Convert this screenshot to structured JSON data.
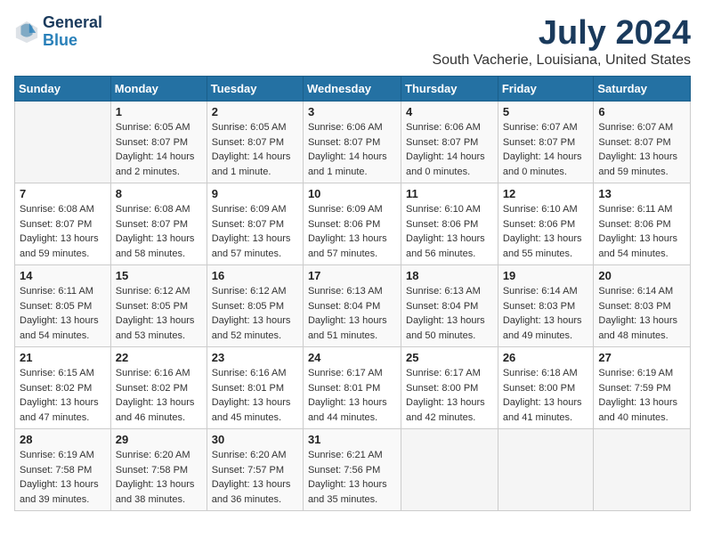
{
  "header": {
    "logo_line1": "General",
    "logo_line2": "Blue",
    "title": "July 2024",
    "location": "South Vacherie, Louisiana, United States"
  },
  "weekdays": [
    "Sunday",
    "Monday",
    "Tuesday",
    "Wednesday",
    "Thursday",
    "Friday",
    "Saturday"
  ],
  "weeks": [
    [
      {
        "day": "",
        "sunrise": "",
        "sunset": "",
        "daylight": ""
      },
      {
        "day": "1",
        "sunrise": "6:05 AM",
        "sunset": "8:07 PM",
        "daylight": "14 hours and 2 minutes."
      },
      {
        "day": "2",
        "sunrise": "6:05 AM",
        "sunset": "8:07 PM",
        "daylight": "14 hours and 1 minute."
      },
      {
        "day": "3",
        "sunrise": "6:06 AM",
        "sunset": "8:07 PM",
        "daylight": "14 hours and 1 minute."
      },
      {
        "day": "4",
        "sunrise": "6:06 AM",
        "sunset": "8:07 PM",
        "daylight": "14 hours and 0 minutes."
      },
      {
        "day": "5",
        "sunrise": "6:07 AM",
        "sunset": "8:07 PM",
        "daylight": "14 hours and 0 minutes."
      },
      {
        "day": "6",
        "sunrise": "6:07 AM",
        "sunset": "8:07 PM",
        "daylight": "13 hours and 59 minutes."
      }
    ],
    [
      {
        "day": "7",
        "sunrise": "6:08 AM",
        "sunset": "8:07 PM",
        "daylight": "13 hours and 59 minutes."
      },
      {
        "day": "8",
        "sunrise": "6:08 AM",
        "sunset": "8:07 PM",
        "daylight": "13 hours and 58 minutes."
      },
      {
        "day": "9",
        "sunrise": "6:09 AM",
        "sunset": "8:07 PM",
        "daylight": "13 hours and 57 minutes."
      },
      {
        "day": "10",
        "sunrise": "6:09 AM",
        "sunset": "8:06 PM",
        "daylight": "13 hours and 57 minutes."
      },
      {
        "day": "11",
        "sunrise": "6:10 AM",
        "sunset": "8:06 PM",
        "daylight": "13 hours and 56 minutes."
      },
      {
        "day": "12",
        "sunrise": "6:10 AM",
        "sunset": "8:06 PM",
        "daylight": "13 hours and 55 minutes."
      },
      {
        "day": "13",
        "sunrise": "6:11 AM",
        "sunset": "8:06 PM",
        "daylight": "13 hours and 54 minutes."
      }
    ],
    [
      {
        "day": "14",
        "sunrise": "6:11 AM",
        "sunset": "8:05 PM",
        "daylight": "13 hours and 54 minutes."
      },
      {
        "day": "15",
        "sunrise": "6:12 AM",
        "sunset": "8:05 PM",
        "daylight": "13 hours and 53 minutes."
      },
      {
        "day": "16",
        "sunrise": "6:12 AM",
        "sunset": "8:05 PM",
        "daylight": "13 hours and 52 minutes."
      },
      {
        "day": "17",
        "sunrise": "6:13 AM",
        "sunset": "8:04 PM",
        "daylight": "13 hours and 51 minutes."
      },
      {
        "day": "18",
        "sunrise": "6:13 AM",
        "sunset": "8:04 PM",
        "daylight": "13 hours and 50 minutes."
      },
      {
        "day": "19",
        "sunrise": "6:14 AM",
        "sunset": "8:03 PM",
        "daylight": "13 hours and 49 minutes."
      },
      {
        "day": "20",
        "sunrise": "6:14 AM",
        "sunset": "8:03 PM",
        "daylight": "13 hours and 48 minutes."
      }
    ],
    [
      {
        "day": "21",
        "sunrise": "6:15 AM",
        "sunset": "8:02 PM",
        "daylight": "13 hours and 47 minutes."
      },
      {
        "day": "22",
        "sunrise": "6:16 AM",
        "sunset": "8:02 PM",
        "daylight": "13 hours and 46 minutes."
      },
      {
        "day": "23",
        "sunrise": "6:16 AM",
        "sunset": "8:01 PM",
        "daylight": "13 hours and 45 minutes."
      },
      {
        "day": "24",
        "sunrise": "6:17 AM",
        "sunset": "8:01 PM",
        "daylight": "13 hours and 44 minutes."
      },
      {
        "day": "25",
        "sunrise": "6:17 AM",
        "sunset": "8:00 PM",
        "daylight": "13 hours and 42 minutes."
      },
      {
        "day": "26",
        "sunrise": "6:18 AM",
        "sunset": "8:00 PM",
        "daylight": "13 hours and 41 minutes."
      },
      {
        "day": "27",
        "sunrise": "6:19 AM",
        "sunset": "7:59 PM",
        "daylight": "13 hours and 40 minutes."
      }
    ],
    [
      {
        "day": "28",
        "sunrise": "6:19 AM",
        "sunset": "7:58 PM",
        "daylight": "13 hours and 39 minutes."
      },
      {
        "day": "29",
        "sunrise": "6:20 AM",
        "sunset": "7:58 PM",
        "daylight": "13 hours and 38 minutes."
      },
      {
        "day": "30",
        "sunrise": "6:20 AM",
        "sunset": "7:57 PM",
        "daylight": "13 hours and 36 minutes."
      },
      {
        "day": "31",
        "sunrise": "6:21 AM",
        "sunset": "7:56 PM",
        "daylight": "13 hours and 35 minutes."
      },
      {
        "day": "",
        "sunrise": "",
        "sunset": "",
        "daylight": ""
      },
      {
        "day": "",
        "sunrise": "",
        "sunset": "",
        "daylight": ""
      },
      {
        "day": "",
        "sunrise": "",
        "sunset": "",
        "daylight": ""
      }
    ]
  ],
  "labels": {
    "sunrise_prefix": "Sunrise: ",
    "sunset_prefix": "Sunset: ",
    "daylight_prefix": "Daylight: "
  }
}
